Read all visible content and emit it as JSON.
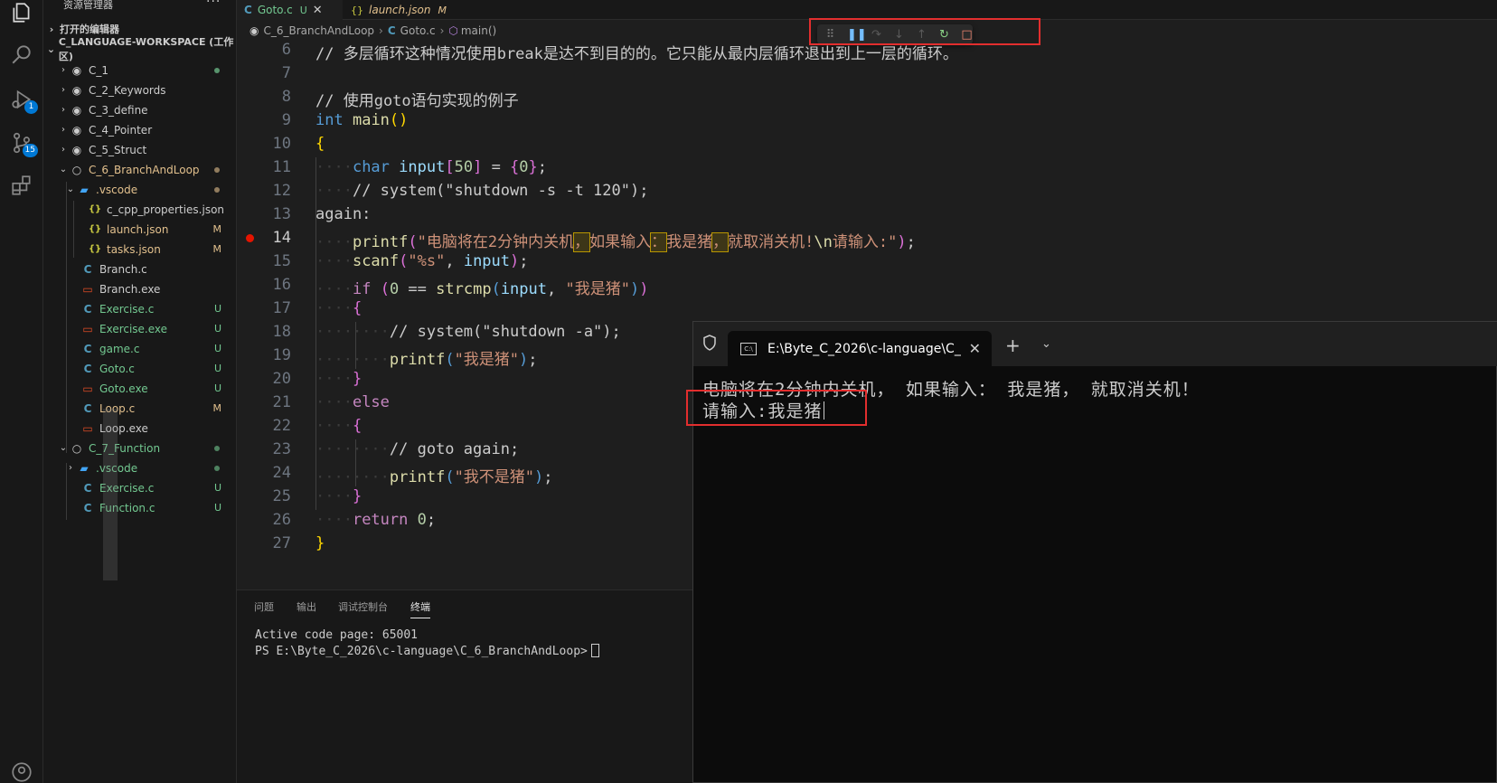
{
  "sidebar": {
    "title": "资源管理器",
    "more": "···",
    "open_editors": "打开的编辑器",
    "workspace": "C_LANGUAGE-WORKSPACE (工作区)",
    "items": [
      {
        "label": "C_1",
        "status": ""
      },
      {
        "label": "C_2_Keywords",
        "status": ""
      },
      {
        "label": "C_3_define",
        "status": ""
      },
      {
        "label": "C_4_Pointer",
        "status": ""
      },
      {
        "label": "C_5_Struct",
        "status": ""
      },
      {
        "label": "C_6_BranchAndLoop",
        "status": ""
      },
      {
        "label": ".vscode",
        "status": ""
      },
      {
        "label": "c_cpp_properties.json",
        "status": ""
      },
      {
        "label": "launch.json",
        "status": "M"
      },
      {
        "label": "tasks.json",
        "status": "M"
      },
      {
        "label": "Branch.c",
        "status": ""
      },
      {
        "label": "Branch.exe",
        "status": ""
      },
      {
        "label": "Exercise.c",
        "status": "U"
      },
      {
        "label": "Exercise.exe",
        "status": "U"
      },
      {
        "label": "game.c",
        "status": "U"
      },
      {
        "label": "Goto.c",
        "status": "U"
      },
      {
        "label": "Goto.exe",
        "status": "U"
      },
      {
        "label": "Loop.c",
        "status": "M"
      },
      {
        "label": "Loop.exe",
        "status": ""
      },
      {
        "label": "C_7_Function",
        "status": ""
      },
      {
        "label": ".vscode",
        "status": ""
      },
      {
        "label": "Exercise.c",
        "status": "U"
      },
      {
        "label": "Function.c",
        "status": "U"
      }
    ]
  },
  "activity": {
    "run_badge": "1",
    "scm_badge": "15"
  },
  "tabs": [
    {
      "label": "Goto.c",
      "status": "U"
    },
    {
      "label": "launch.json",
      "status": "M"
    }
  ],
  "breadcrumb": {
    "folder": "C_6_BranchAndLoop",
    "file": "Goto.c",
    "symbol": "main()"
  },
  "code": {
    "line_numbers": [
      "6",
      "7",
      "8",
      "9",
      "10",
      "11",
      "12",
      "13",
      "14",
      "15",
      "16",
      "17",
      "18",
      "19",
      "20",
      "21",
      "22",
      "23",
      "24",
      "25",
      "26",
      "27"
    ],
    "l6": "// 多层循环这种情况使用break是达不到目的的。它只能从最内层循环退出到上一层的循环。",
    "l8": "// 使用goto语句实现的例子",
    "l9_kw": "int",
    "l9_fn": "main",
    "l9_p": "()",
    "l10": "{",
    "l11_kw": "char",
    "l11_var": "input",
    "l11_idx": "50",
    "l11_eq": " = ",
    "l11_init": "0",
    "l12": "// system(\"shutdown -s -t 120\");",
    "l13": "again:",
    "l14_fn": "printf",
    "l14_s1": "\"电脑将在2分钟内关机",
    "l14_s2": "如果输入",
    "l14_s3": "我是猪",
    "l14_s4": "就取消关机!",
    "l14_esc": "\\n",
    "l14_s5": "请输入:\"",
    "l14_c1": "，",
    "l14_c2": "：",
    "l14_c3": "，",
    "l15_fn": "scanf",
    "l15_str": "\"%s\"",
    "l15_var": "input",
    "l16_kw": "if",
    "l16_num": "0",
    "l16_op": " == ",
    "l16_fn": "strcmp",
    "l16_var": "input",
    "l16_str": "\"我是猪\"",
    "l17": "{",
    "l18": "// system(\"shutdown -a\");",
    "l19_fn": "printf",
    "l19_str": "\"我是猪\"",
    "l20": "}",
    "l21": "else",
    "l22": "{",
    "l23": "// goto again;",
    "l24_fn": "printf",
    "l24_str": "\"我不是猪\"",
    "l25": "}",
    "l26_kw": "return",
    "l26_num": "0",
    "l27": "}"
  },
  "panel": {
    "tabs": [
      "问题",
      "输出",
      "调试控制台",
      "终端"
    ],
    "line1": "Active code page: 65001",
    "line2": "PS E:\\Byte_C_2026\\c-language\\C_6_BranchAndLoop>"
  },
  "terminal_window": {
    "tab_title": "E:\\Byte_C_2026\\c-language\\C_",
    "output_line": "电脑将在2分钟内关机， 如果输入： 我是猪， 就取消关机！",
    "input_line": "请输入:我是猪"
  },
  "colors": {
    "accent": "#0078d4",
    "annotation_box": "#e22e2e",
    "untracked": "#73c991",
    "modified": "#e2c08d"
  }
}
